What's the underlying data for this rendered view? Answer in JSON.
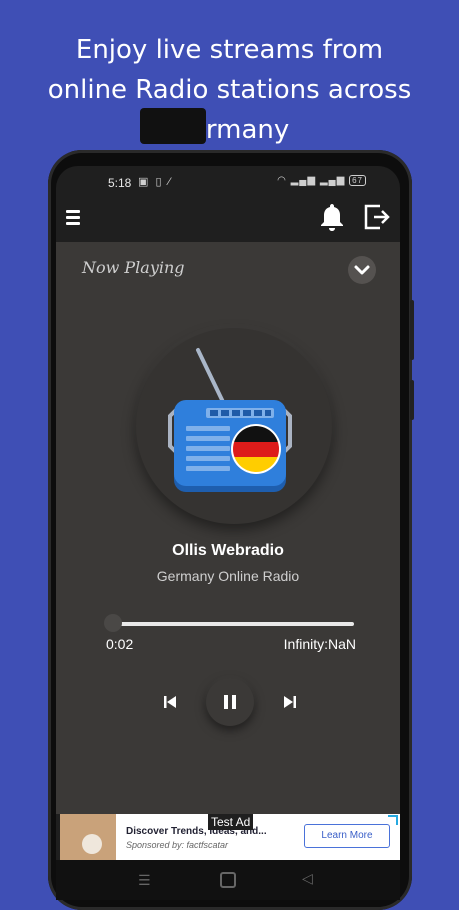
{
  "headline": {
    "line1": "Enjoy live streams from",
    "line2": "online Radio stations across",
    "line3": "Germany"
  },
  "status_bar": {
    "time": "5:18",
    "battery": "67"
  },
  "app_bar": {
    "menu_icon": "hamburger-menu-icon",
    "bell_icon": "bell-icon",
    "logout_icon": "logout-icon"
  },
  "player": {
    "section_title": "Now Playing",
    "station_name": "Ollis Webradio",
    "station_description": "Germany Online Radio",
    "current_time": "0:02",
    "total_time": "Infinity:NaN",
    "is_playing": true
  },
  "ad": {
    "label": "Test Ad",
    "title": "Discover Trends, Ideas, and...",
    "sponsor": "Sponsored by: factfscatar",
    "cta": "Learn More"
  },
  "colors": {
    "background": "#3f4fb5",
    "card": "#3b3937",
    "radio_blue": "#2f7fdc"
  }
}
